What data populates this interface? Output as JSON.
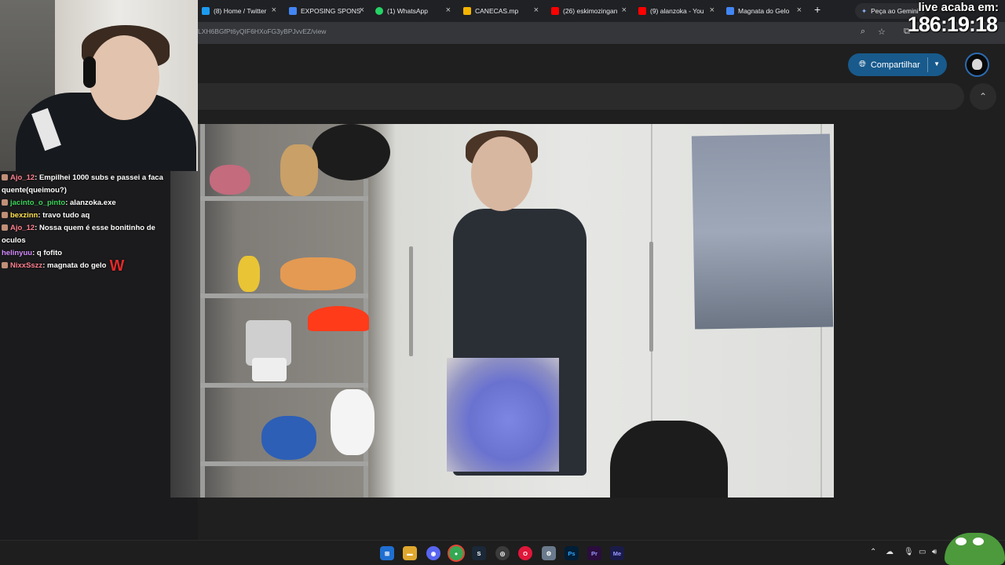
{
  "browser": {
    "tabs": [
      {
        "label": "(8) Home / Twitter",
        "color": "#1d9bf0"
      },
      {
        "label": "EXPOSING SPONS",
        "color": "#4285f4"
      },
      {
        "label": "(1) WhatsApp",
        "color": "#25d366"
      },
      {
        "label": "CANECAS.mp",
        "color": "#f4b400"
      },
      {
        "label": "(26) eskimozingan",
        "color": "#ff0000"
      },
      {
        "label": "(9) alanzoka - You",
        "color": "#ff0000"
      },
      {
        "label": "Magnata do Gelo",
        "color": "#4285f4"
      }
    ],
    "gemini_label": "Peça ao Gemini",
    "url": "LXH6BGfPt6yQIF6HXoFG3yBPJvvEZ/view"
  },
  "drive": {
    "share_label": "Compartilhar"
  },
  "stream": {
    "timer_label": "live acaba em:",
    "timer_value": "186:19:18"
  },
  "chat": [
    {
      "user": "Ajo_12",
      "user_color": "#ff7f8e",
      "text": "Empilhei 1000 subs e passei a faca quente(queimou?)"
    },
    {
      "user": "jacinto_o_pinto",
      "user_color": "#3cd55a",
      "text": "alanzoka.exe"
    },
    {
      "user": "bexzinn",
      "user_color": "#ffe14d",
      "text": "travo tudo aq"
    },
    {
      "user": "Ajo_12",
      "user_color": "#ff7f8e",
      "text": "Nossa quem é esse bonitinho de oculos"
    },
    {
      "user": "helinyuu",
      "user_color": "#d58bff",
      "text": "q fofito"
    },
    {
      "user": "NixxSszz",
      "user_color": "#ff7f8e",
      "text": "magnata do gelo"
    }
  ],
  "taskbar": {
    "apps": [
      {
        "name": "windows-start",
        "color": "#3aa0ff",
        "glyph": "⊞"
      },
      {
        "name": "file-explorer",
        "color": "#f2c14e",
        "glyph": "▬"
      },
      {
        "name": "discord",
        "color": "#5865f2",
        "glyph": "◉"
      },
      {
        "name": "chrome",
        "color": "#34a853",
        "glyph": "●"
      },
      {
        "name": "steam",
        "color": "#1b2838",
        "glyph": "S"
      },
      {
        "name": "obs",
        "color": "#3b3b3b",
        "glyph": "◎"
      },
      {
        "name": "opera",
        "color": "#e0173a",
        "glyph": "O"
      },
      {
        "name": "settings",
        "color": "#6a7a8c",
        "glyph": "⚙"
      },
      {
        "name": "photoshop",
        "color": "#001e36",
        "glyph": "Ps"
      },
      {
        "name": "premiere",
        "color": "#2a0d3d",
        "glyph": "Pr"
      },
      {
        "name": "media-encoder",
        "color": "#1b1b4a",
        "glyph": "Me"
      }
    ]
  }
}
